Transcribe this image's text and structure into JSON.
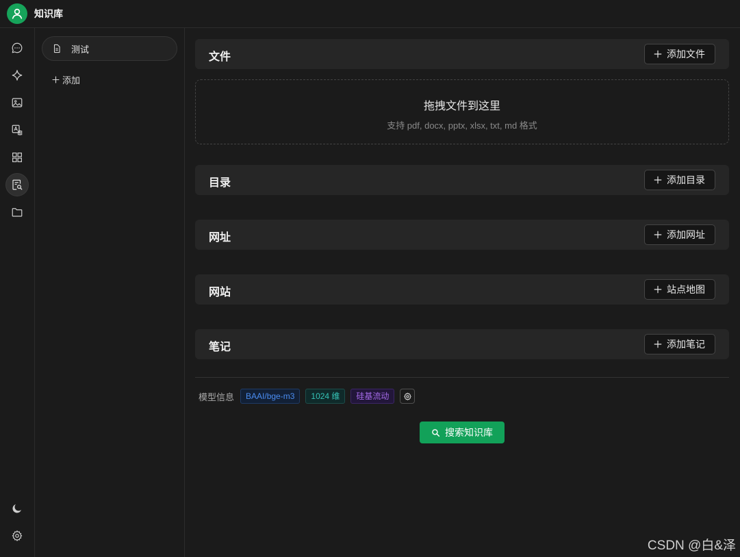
{
  "app": {
    "title": "知识库"
  },
  "sidebar": {
    "items": [
      {
        "icon": "chat-icon"
      },
      {
        "icon": "sparkle-icon"
      },
      {
        "icon": "image-icon"
      },
      {
        "icon": "translate-icon"
      },
      {
        "icon": "apps-grid-icon"
      },
      {
        "icon": "knowledge-search-icon",
        "active": true
      },
      {
        "icon": "folder-icon"
      }
    ],
    "bottom": [
      {
        "icon": "moon-icon"
      },
      {
        "icon": "gear-icon"
      }
    ]
  },
  "knowledge_list": {
    "items": [
      {
        "label": "测试",
        "icon": "document-icon"
      }
    ],
    "add_label": "添加"
  },
  "sections": [
    {
      "title": "文件",
      "button": "添加文件"
    },
    {
      "title": "目录",
      "button": "添加目录"
    },
    {
      "title": "网址",
      "button": "添加网址"
    },
    {
      "title": "网站",
      "button": "站点地图"
    },
    {
      "title": "笔记",
      "button": "添加笔记"
    }
  ],
  "dropzone": {
    "title": "拖拽文件到这里",
    "subtitle": "支持 pdf, docx, pptx, xlsx, txt, md 格式"
  },
  "model_info": {
    "label": "模型信息",
    "model": "BAAI/bge-m3",
    "dimensions": "1024 维",
    "provider": "硅基流动"
  },
  "search_button": "搜索知识库",
  "watermark": "CSDN @白&泽",
  "colors": {
    "accent": "#12a159",
    "background": "#1b1b1b",
    "panel": "#262626"
  }
}
